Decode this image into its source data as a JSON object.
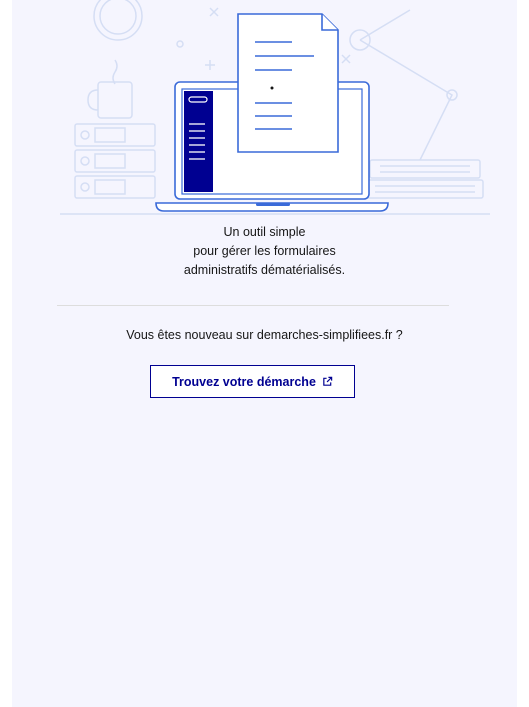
{
  "hero": {
    "tagline_lines": [
      "Un outil simple",
      "pour gérer les formulaires",
      "administratifs dématérialisés."
    ]
  },
  "signup": {
    "question": "Vous êtes nouveau sur demarches-simplifiees.fr ?",
    "cta_label": "Trouvez votre démarche",
    "cta_icon": "external-link-icon"
  },
  "colors": {
    "accent": "#000091",
    "background": "#f5f5fe",
    "illustration_line": "#c8d4f2",
    "illustration_blue": "#3a6ad9"
  }
}
